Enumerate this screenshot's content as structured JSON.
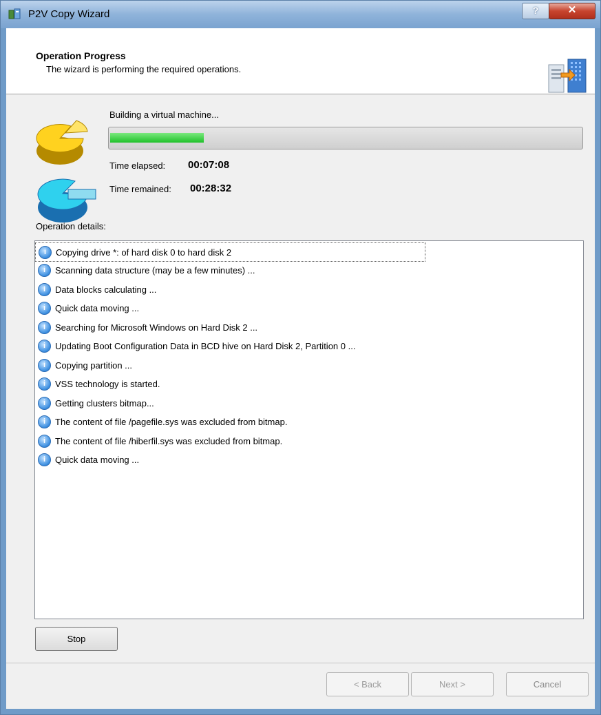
{
  "window": {
    "title": "P2V Copy Wizard",
    "help_label": "?",
    "close_label": "✕"
  },
  "header": {
    "title": "Operation Progress",
    "subtitle": "The wizard is performing the required operations."
  },
  "progress": {
    "status_text": "Building a virtual machine...",
    "percent": 20,
    "fill_color": "#1fc12a",
    "elapsed_label": "Time elapsed:",
    "elapsed_value": "00:07:08",
    "remained_label": "Time remained:",
    "remained_value": "00:28:32"
  },
  "details": {
    "label": "Operation details:",
    "items": [
      "Copying drive *: of hard disk 0 to hard disk 2",
      "Scanning data structure (may be a few minutes) ...",
      "Data blocks calculating ...",
      "Quick data moving ...",
      "Searching for Microsoft Windows on Hard Disk 2 ...",
      "Updating Boot Configuration Data in BCD hive on Hard Disk 2, Partition 0 ...",
      "Copying partition ...",
      "VSS technology is started.",
      "Getting clusters bitmap...",
      "The content of file /pagefile.sys was excluded from bitmap.",
      "The content of file /hiberfil.sys was excluded from bitmap.",
      "Quick data moving ..."
    ]
  },
  "buttons": {
    "stop": "Stop",
    "back": "< Back",
    "next": "Next >",
    "cancel": "Cancel"
  },
  "icons": {
    "app": "p2v-wizard-icon",
    "header": "server-migration-icon",
    "progress_top": "yellow-pie-chart-icon",
    "progress_bottom": "blue-pie-chart-icon",
    "list_item": "info-icon"
  }
}
